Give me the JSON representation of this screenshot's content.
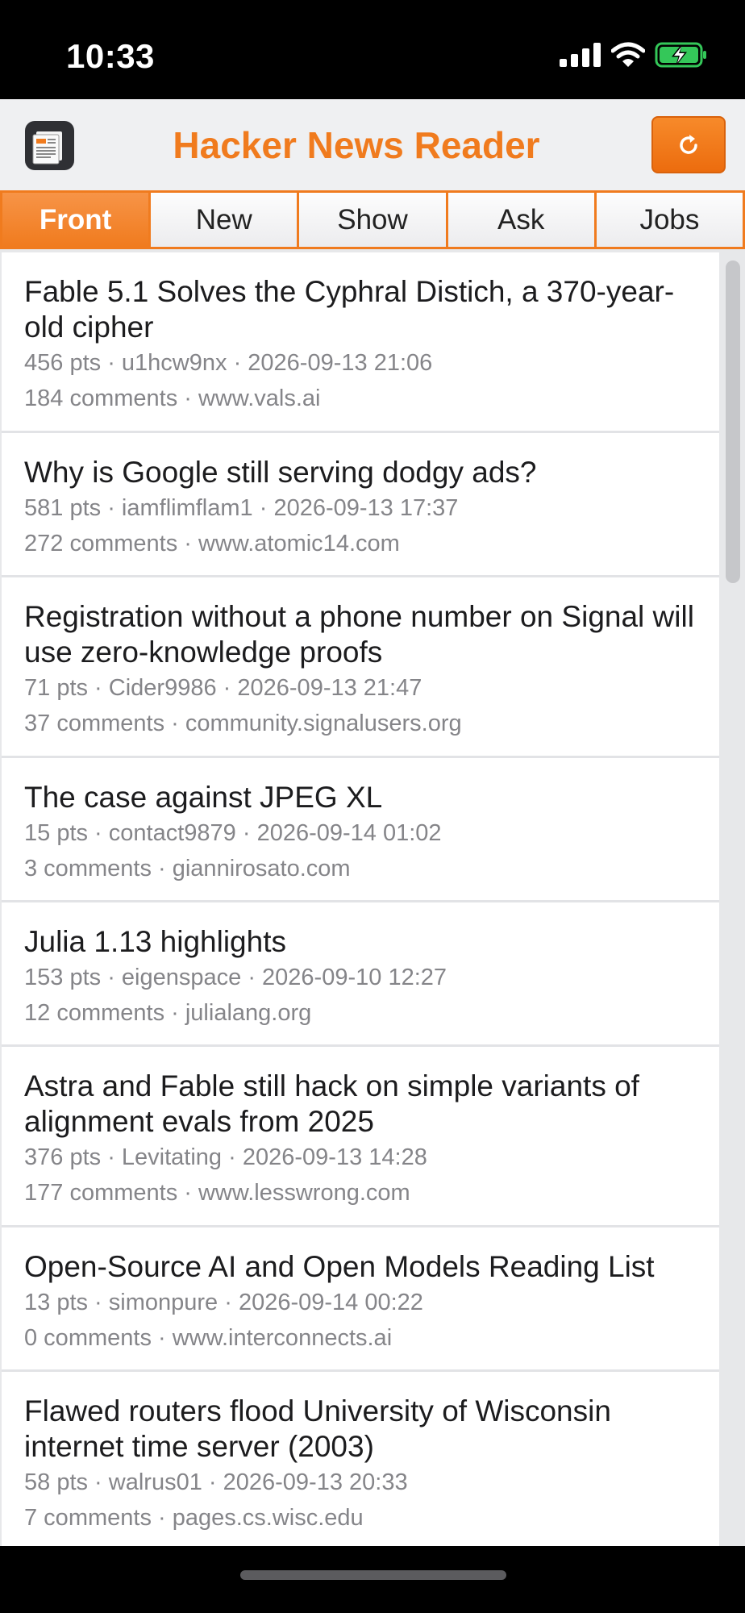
{
  "status_bar": {
    "time": "10:33"
  },
  "header": {
    "title": "Hacker News Reader",
    "app_icon": "newspaper-app-icon",
    "refresh_icon": "refresh-icon",
    "accent_color": "#f07b1e"
  },
  "tabs": [
    {
      "label": "Front",
      "active": true
    },
    {
      "label": "New",
      "active": false
    },
    {
      "label": "Show",
      "active": false
    },
    {
      "label": "Ask",
      "active": false
    },
    {
      "label": "Jobs",
      "active": false
    }
  ],
  "stories": [
    {
      "title": "Fable 5.1 Solves the Cyphral Distich, a 370-year-old cipher",
      "points": "456 pts",
      "user": "u1hcw9nx",
      "time": "2026-09-13 21:06",
      "comments": "184 comments",
      "domain": "www.vals.ai"
    },
    {
      "title": "Why is Google still serving dodgy ads?",
      "points": "581 pts",
      "user": "iamflimflam1",
      "time": "2026-09-13 17:37",
      "comments": "272 comments",
      "domain": "www.atomic14.com"
    },
    {
      "title": "Registration without a phone number on Signal will use zero-knowledge proofs",
      "points": "71 pts",
      "user": "Cider9986",
      "time": "2026-09-13 21:47",
      "comments": "37 comments",
      "domain": "community.signalusers.org"
    },
    {
      "title": "The case against JPEG XL",
      "points": "15 pts",
      "user": "contact9879",
      "time": "2026-09-14 01:02",
      "comments": "3 comments",
      "domain": "giannirosato.com"
    },
    {
      "title": "Julia 1.13 highlights",
      "points": "153 pts",
      "user": "eigenspace",
      "time": "2026-09-10 12:27",
      "comments": "12 comments",
      "domain": "julialang.org"
    },
    {
      "title": "Astra and Fable still hack on simple variants of alignment evals from 2025",
      "points": "376 pts",
      "user": "Levitating",
      "time": "2026-09-13 14:28",
      "comments": "177 comments",
      "domain": "www.lesswrong.com"
    },
    {
      "title": "Open-Source AI and Open Models Reading List",
      "points": "13 pts",
      "user": "simonpure",
      "time": "2026-09-14 00:22",
      "comments": "0 comments",
      "domain": "www.interconnects.ai"
    },
    {
      "title": "Flawed routers flood University of Wisconsin internet time server (2003)",
      "points": "58 pts",
      "user": "walrus01",
      "time": "2026-09-13 20:33",
      "comments": "7 comments",
      "domain": "pages.cs.wisc.edu"
    }
  ]
}
